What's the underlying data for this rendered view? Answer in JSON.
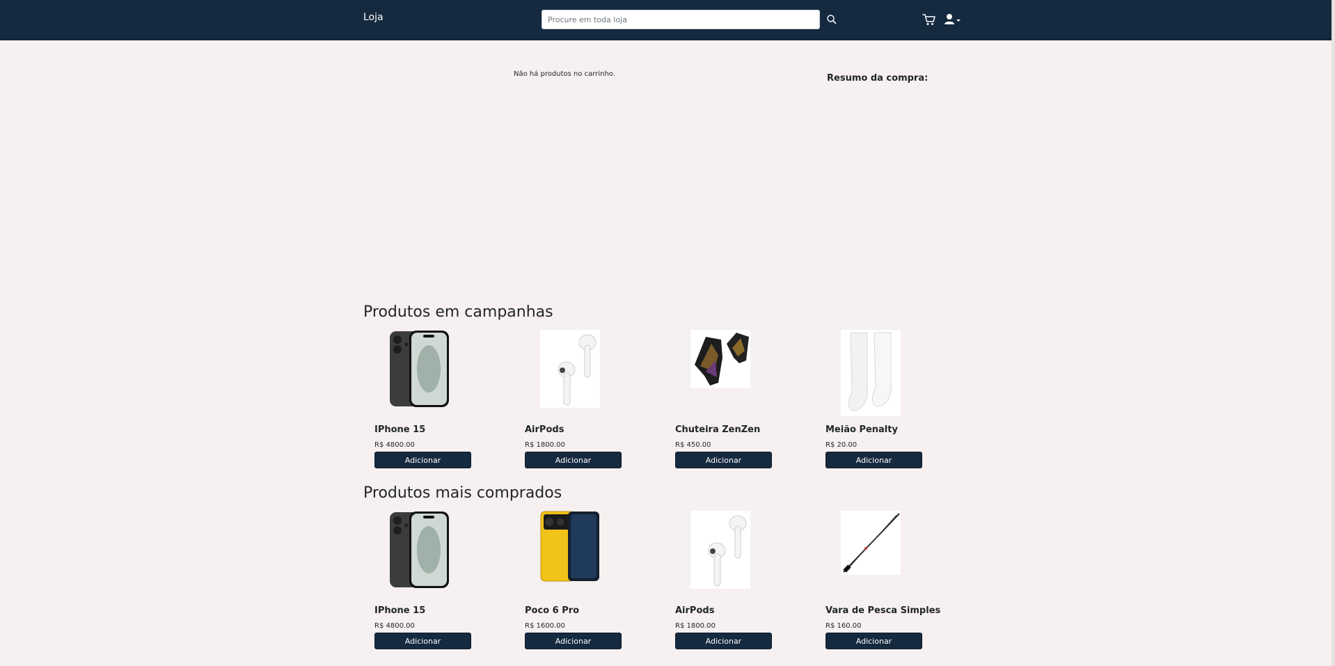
{
  "navbar": {
    "brand": "Loja",
    "search_placeholder": "Procure em toda loja"
  },
  "cart": {
    "empty_message": "Não há produtos no carrinho.",
    "summary_title": "Resumo da compra:"
  },
  "sections": [
    {
      "title": "Produtos em campanhas",
      "products": [
        {
          "name": "IPhone 15",
          "price": "R$ 4800.00",
          "button": "Adicionar",
          "image": "iphone-image"
        },
        {
          "name": "AirPods",
          "price": "R$ 1800.00",
          "button": "Adicionar",
          "image": "airpods-image"
        },
        {
          "name": "Chuteira ZenZen",
          "price": "R$ 450.00",
          "button": "Adicionar",
          "image": "boots-image"
        },
        {
          "name": "Meião Penalty",
          "price": "R$ 20.00",
          "button": "Adicionar",
          "image": "socks-image"
        }
      ]
    },
    {
      "title": "Produtos mais comprados",
      "products": [
        {
          "name": "IPhone 15",
          "price": "R$ 4800.00",
          "button": "Adicionar",
          "image": "iphone-image"
        },
        {
          "name": "Poco 6 Pro",
          "price": "R$ 1600.00",
          "button": "Adicionar",
          "image": "poco-phone-image"
        },
        {
          "name": "AirPods",
          "price": "R$ 1800.00",
          "button": "Adicionar",
          "image": "airpods-image"
        },
        {
          "name": "Vara de Pesca Simples",
          "price": "R$ 160.00",
          "button": "Adicionar",
          "image": "fishing-rod-image"
        }
      ]
    }
  ],
  "colors": {
    "navbar": "#15293f",
    "background": "#f6f0f0",
    "button": "#15293f"
  }
}
